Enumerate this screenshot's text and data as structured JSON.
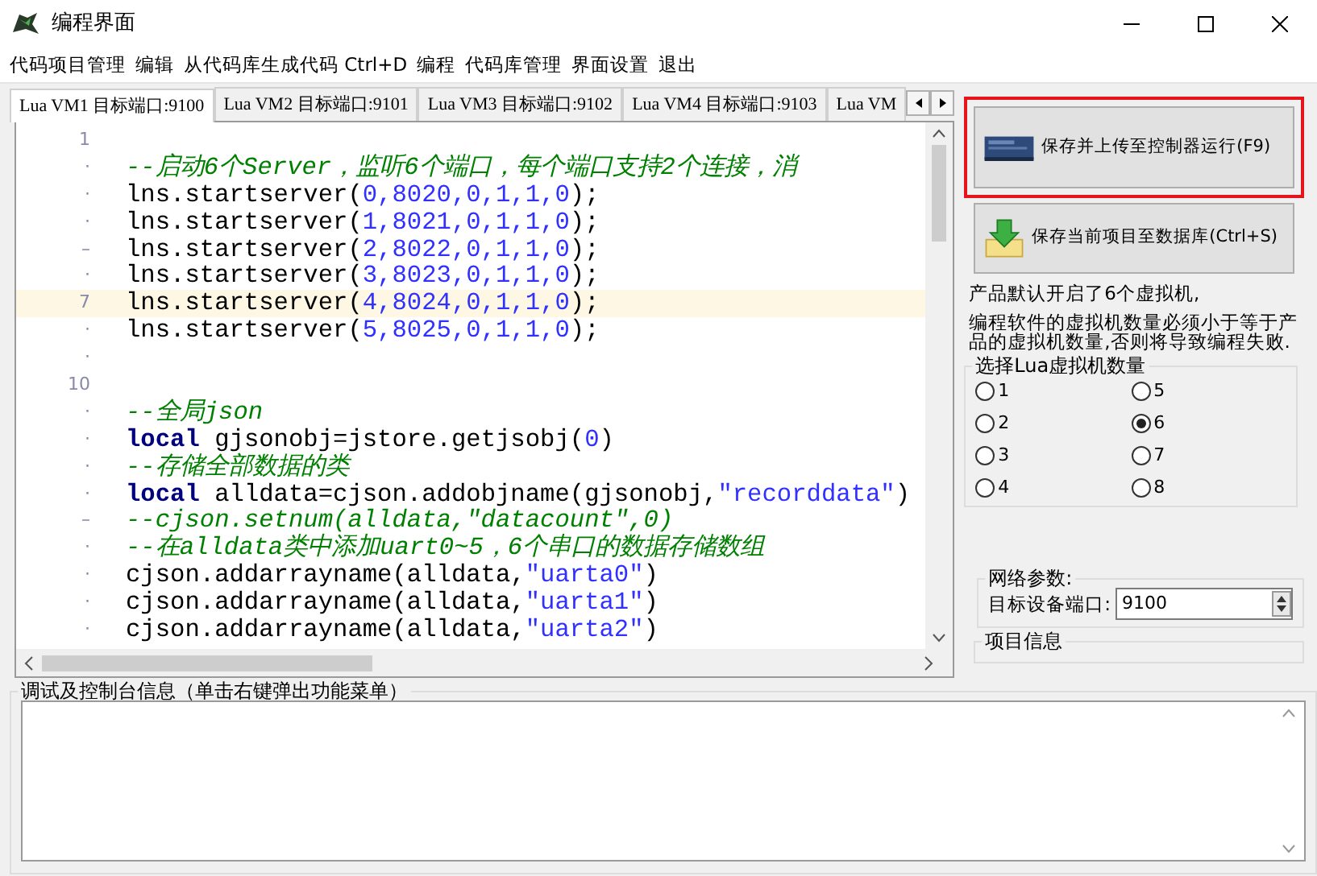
{
  "window": {
    "title": "编程界面"
  },
  "menu": [
    "代码项目管理",
    "编辑",
    "从代码库生成代码 Ctrl+D",
    "编程",
    "代码库管理",
    "界面设置",
    "退出"
  ],
  "tabs": [
    {
      "label": "Lua VM1 目标端口:9100",
      "selected": true
    },
    {
      "label": "Lua VM2 目标端口:9101",
      "selected": false
    },
    {
      "label": "Lua VM3 目标端口:9102",
      "selected": false
    },
    {
      "label": "Lua VM4 目标端口:9103",
      "selected": false
    },
    {
      "label": "Lua VM",
      "selected": false
    }
  ],
  "editor": {
    "lines": [
      {
        "gutter": "1",
        "current": false
      },
      {
        "gutter": "·",
        "current": false,
        "tokens": [
          {
            "kind": "comment",
            "text": "--启动6个Server，监听6个端口，每个端口支持2个连接，消"
          }
        ]
      },
      {
        "gutter": "·",
        "current": false,
        "tokens": [
          {
            "kind": "plain",
            "text": "lns.startserver("
          },
          {
            "kind": "number",
            "text": "0,8020,0,1,1,0"
          },
          {
            "kind": "plain",
            "text": ");"
          }
        ]
      },
      {
        "gutter": "·",
        "current": false,
        "tokens": [
          {
            "kind": "plain",
            "text": "lns.startserver("
          },
          {
            "kind": "number",
            "text": "1,8021,0,1,1,0"
          },
          {
            "kind": "plain",
            "text": ");"
          }
        ]
      },
      {
        "gutter": "–",
        "current": false,
        "tokens": [
          {
            "kind": "plain",
            "text": "lns.startserver("
          },
          {
            "kind": "number",
            "text": "2,8022,0,1,1,0"
          },
          {
            "kind": "plain",
            "text": ");"
          }
        ]
      },
      {
        "gutter": "·",
        "current": false,
        "tokens": [
          {
            "kind": "plain",
            "text": "lns.startserver("
          },
          {
            "kind": "number",
            "text": "3,8023,0,1,1,0"
          },
          {
            "kind": "plain",
            "text": ");"
          }
        ]
      },
      {
        "gutter": "7",
        "current": true,
        "tokens": [
          {
            "kind": "plain",
            "text": "lns.startserver("
          },
          {
            "kind": "number",
            "text": "4,8024,0,1,1,0"
          },
          {
            "kind": "plain",
            "text": ");"
          }
        ]
      },
      {
        "gutter": "·",
        "current": false,
        "tokens": [
          {
            "kind": "plain",
            "text": "lns.startserver("
          },
          {
            "kind": "number",
            "text": "5,8025,0,1,1,0"
          },
          {
            "kind": "plain",
            "text": ");"
          }
        ]
      },
      {
        "gutter": "·",
        "current": false
      },
      {
        "gutter": "10",
        "current": false
      },
      {
        "gutter": "·",
        "current": false,
        "tokens": [
          {
            "kind": "comment",
            "text": "--全局json"
          }
        ]
      },
      {
        "gutter": "·",
        "current": false,
        "tokens": [
          {
            "kind": "keyword",
            "text": "local"
          },
          {
            "kind": "plain",
            "text": " gjsonobj=jstore.getjsobj("
          },
          {
            "kind": "number",
            "text": "0"
          },
          {
            "kind": "plain",
            "text": ")"
          }
        ]
      },
      {
        "gutter": "·",
        "current": false,
        "tokens": [
          {
            "kind": "comment",
            "text": "--存储全部数据的类"
          }
        ]
      },
      {
        "gutter": "·",
        "current": false,
        "tokens": [
          {
            "kind": "keyword",
            "text": "local"
          },
          {
            "kind": "plain",
            "text": " alldata=cjson.addobjname(gjsonobj,"
          },
          {
            "kind": "string",
            "text": "\"recorddata\""
          },
          {
            "kind": "plain",
            "text": ")"
          }
        ]
      },
      {
        "gutter": "–",
        "current": false,
        "tokens": [
          {
            "kind": "comment",
            "text": "--cjson.setnum(alldata,\"datacount\",0)"
          }
        ]
      },
      {
        "gutter": "·",
        "current": false,
        "tokens": [
          {
            "kind": "comment",
            "text": "--在alldata类中添加uart0~5，6个串口的数据存储数组"
          }
        ]
      },
      {
        "gutter": "·",
        "current": false,
        "tokens": [
          {
            "kind": "plain",
            "text": "cjson.addarrayname(alldata,"
          },
          {
            "kind": "string",
            "text": "\"uarta0\""
          },
          {
            "kind": "plain",
            "text": ")"
          }
        ]
      },
      {
        "gutter": "·",
        "current": false,
        "tokens": [
          {
            "kind": "plain",
            "text": "cjson.addarrayname(alldata,"
          },
          {
            "kind": "string",
            "text": "\"uarta1\""
          },
          {
            "kind": "plain",
            "text": ")"
          }
        ]
      },
      {
        "gutter": "·",
        "current": false,
        "tokens": [
          {
            "kind": "plain",
            "text": "cjson.addarrayname(alldata,"
          },
          {
            "kind": "string",
            "text": "\"uarta2\""
          },
          {
            "kind": "plain",
            "text": ")"
          }
        ]
      }
    ]
  },
  "side": {
    "upload_button": {
      "label": "保存并上传至控制器运行(F9)",
      "highlighted": true
    },
    "save_button": {
      "label": "保存当前项目至数据库(Ctrl+S)"
    },
    "notes": [
      "产品默认开启了6个虚拟机,",
      "编程软件的虚拟机数量必须小于等于产品的虚拟机数量,否则将导致编程失败."
    ],
    "vm_group": {
      "title": "选择Lua虚拟机数量",
      "options": [
        {
          "label": "1",
          "selected": false
        },
        {
          "label": "2",
          "selected": false
        },
        {
          "label": "3",
          "selected": false
        },
        {
          "label": "4",
          "selected": false
        },
        {
          "label": "5",
          "selected": false
        },
        {
          "label": "6",
          "selected": true
        },
        {
          "label": "7",
          "selected": false
        },
        {
          "label": "8",
          "selected": false
        }
      ]
    },
    "network": {
      "title": "网络参数:",
      "port_label": "目标设备端口:",
      "port_value": "9100"
    },
    "project_info": {
      "title": "项目信息"
    }
  },
  "console": {
    "title": "调试及控制台信息（单击右键弹出功能菜单）"
  }
}
